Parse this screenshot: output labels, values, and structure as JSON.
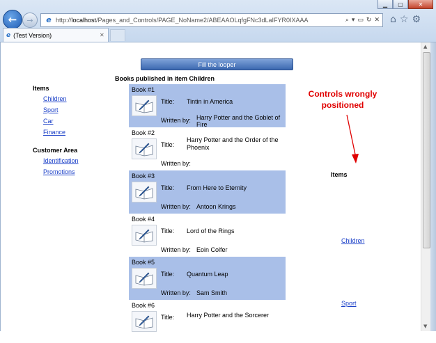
{
  "browser": {
    "url_prefix": "http://",
    "url_host": "localhost",
    "url_path": "/Pages_and_Controls/PAGE_NoName2/ABEAAOLqfgFNc3dLaIFYR0IXAAA",
    "tab_title": "(Test Version)",
    "tools": [
      "search-icon",
      "dropdown-icon",
      "lock-icon",
      "refresh-icon",
      "stop-icon"
    ],
    "right_tools": [
      "home-icon",
      "star-icon",
      "gear-icon"
    ]
  },
  "page": {
    "button_label": "Fill the looper",
    "looper_title": "Books published in item Children",
    "sidebar": {
      "items_heading": "Items",
      "items": [
        "Children",
        "Sport",
        "Car",
        "Finance"
      ],
      "customer_heading": "Customer Area",
      "customer_links": [
        "Identification",
        "Promotions"
      ]
    },
    "books": [
      {
        "num": "Book #1",
        "title_label": "Title:",
        "title": "Tintin in America",
        "written_label": "Written by:",
        "author": "Harry Potter and the Goblet of Fire"
      },
      {
        "num": "Book #2",
        "title_label": "Title:",
        "title": "Harry Potter and the Order of the Phoenix",
        "written_label": "Written by:",
        "author": ""
      },
      {
        "num": "Book #3",
        "title_label": "Title:",
        "title": "From Here to Eternity",
        "written_label": "Written by:",
        "author": "Antoon Krings"
      },
      {
        "num": "Book #4",
        "title_label": "Title:",
        "title": "Lord of the Rings",
        "written_label": "Written by:",
        "author": "Eoin Colfer"
      },
      {
        "num": "Book #5",
        "title_label": "Title:",
        "title": "Quantum Leap",
        "written_label": "Written by:",
        "author": "Sam Smith"
      },
      {
        "num": "Book #6",
        "title_label": "Title:",
        "title": "Harry Potter and the Sorcerer",
        "written_label": "",
        "author": ""
      }
    ],
    "right_items_label": "Items",
    "right_links": [
      "Children",
      "Sport"
    ]
  },
  "annotation": {
    "line1": "Controls wrongly",
    "line2": "positioned",
    "color": "#e00000"
  },
  "colors": {
    "row_alt": "#a9bfe8",
    "link": "#1a3fc8",
    "button": "#3c68b0"
  }
}
